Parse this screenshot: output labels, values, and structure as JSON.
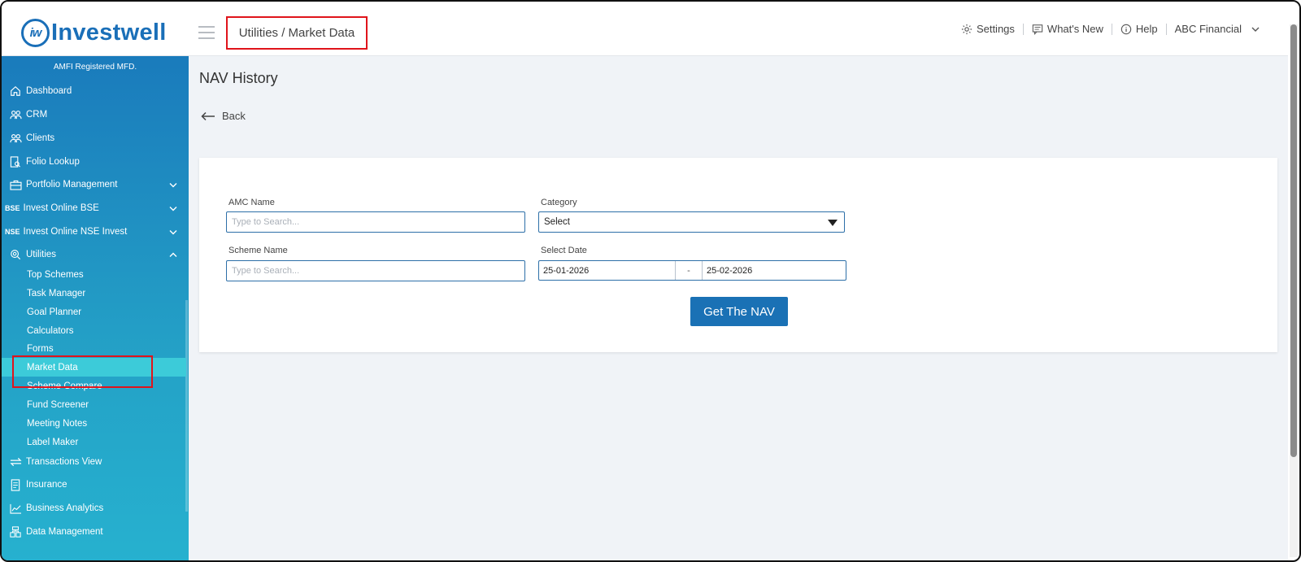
{
  "brand": {
    "logo_mark": "iw",
    "name": "Investwell"
  },
  "header": {
    "breadcrumb": "Utilities / Market Data",
    "settings": "Settings",
    "whats_new": "What's New",
    "help": "Help",
    "account": "ABC Financial"
  },
  "sidebar": {
    "amfi": "AMFI Registered MFD.",
    "items": [
      {
        "label": "Dashboard",
        "icon": "home-icon"
      },
      {
        "label": "CRM",
        "icon": "users-icon"
      },
      {
        "label": "Clients",
        "icon": "users-icon"
      },
      {
        "label": "Folio Lookup",
        "icon": "folio-icon"
      },
      {
        "label": "Portfolio Management",
        "icon": "briefcase-icon"
      },
      {
        "label": "Invest Online BSE",
        "tag": "BSE"
      },
      {
        "label": "Invest Online NSE Invest",
        "tag": "NSE"
      },
      {
        "label": "Utilities",
        "icon": "utilities-icon"
      }
    ],
    "sub_items": [
      "Top Schemes",
      "Task Manager",
      "Goal Planner",
      "Calculators",
      "Forms",
      "Market Data",
      "Scheme Compare",
      "Fund Screener",
      "Meeting Notes",
      "Label Maker"
    ],
    "lower_items": [
      {
        "label": "Transactions View",
        "icon": "transfer-icon"
      },
      {
        "label": "Insurance",
        "icon": "document-icon"
      },
      {
        "label": "Business Analytics",
        "icon": "chart-icon"
      },
      {
        "label": "Data Management",
        "icon": "database-icon"
      }
    ]
  },
  "main": {
    "title": "NAV History",
    "back": "Back",
    "form": {
      "amc_label": "AMC Name",
      "amc_placeholder": "Type to Search...",
      "category_label": "Category",
      "category_value": "Select",
      "scheme_label": "Scheme Name",
      "scheme_placeholder": "Type to Search...",
      "date_label": "Select Date",
      "date_from": "25-01-2026",
      "date_sep": "-",
      "date_to": "25-02-2026",
      "submit": "Get The NAV"
    }
  },
  "colors": {
    "accent": "#1a71b5",
    "sidebar_top": "#1a7bbc",
    "sidebar_bottom": "#26b1cf",
    "active": "#3ccbd9",
    "highlight": "#e0141b"
  }
}
